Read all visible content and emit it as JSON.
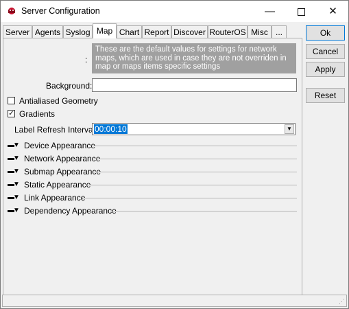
{
  "window": {
    "title": "Server Configuration"
  },
  "tabs": [
    {
      "label": "Server"
    },
    {
      "label": "Agents"
    },
    {
      "label": "Syslog"
    },
    {
      "label": "Map"
    },
    {
      "label": "Chart"
    },
    {
      "label": "Report"
    },
    {
      "label": "Discover"
    },
    {
      "label": "RouterOS"
    },
    {
      "label": "Misc"
    },
    {
      "label": "..."
    }
  ],
  "active_tab": "Map",
  "buttons": {
    "ok": "Ok",
    "cancel": "Cancel",
    "apply": "Apply",
    "reset": "Reset"
  },
  "map": {
    "note_colon": ":",
    "note": "These are the default values for settings for network maps, which are used in case they are not overriden in map or maps items specific settings",
    "background_label": "Background:",
    "background_value": "",
    "antialiased_label": "Antialiased Geometry",
    "antialiased_checked": false,
    "gradients_label": "Gradients",
    "gradients_checked": true,
    "refresh_label": "Label Refresh Interval:",
    "refresh_value": "00:00:10",
    "sections": [
      {
        "label": "Device Appearance"
      },
      {
        "label": "Network Appearance"
      },
      {
        "label": "Submap Appearance"
      },
      {
        "label": "Static Appearance"
      },
      {
        "label": "Link Appearance"
      },
      {
        "label": "Dependency Appearance"
      }
    ]
  },
  "colors": {
    "accent": "#0078d7",
    "note_bg": "#a0a0a0",
    "icon_red": "#c8102e"
  },
  "icons": {
    "app": "app-icon",
    "minimize": "minimize-icon",
    "maximize": "maximize-icon",
    "close": "close-icon",
    "expand": "triangle-down-icon",
    "dropdown": "chevron-down-icon"
  }
}
